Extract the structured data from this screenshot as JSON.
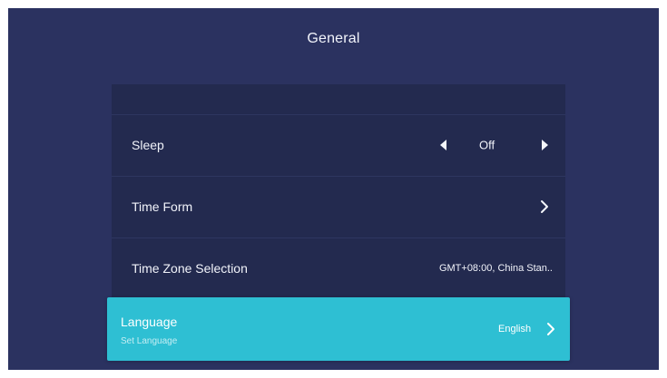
{
  "header": {
    "title": "General"
  },
  "settings": {
    "sleep": {
      "label": "Sleep",
      "value": "Off",
      "left_icon": "triangle-left-icon",
      "right_icon": "triangle-right-icon"
    },
    "time_form": {
      "label": "Time Form",
      "icon": "chevron-right-icon"
    },
    "time_zone": {
      "label": "Time Zone Selection",
      "value": "GMT+08:00, China Stan.."
    },
    "language": {
      "label": "Language",
      "subtitle": "Set Language",
      "value": "English",
      "icon": "chevron-right-icon"
    }
  },
  "colors": {
    "background": "#2b3260",
    "panel": "#232a4f",
    "focus": "#2ebfd3",
    "text": "#f1f3fa"
  }
}
